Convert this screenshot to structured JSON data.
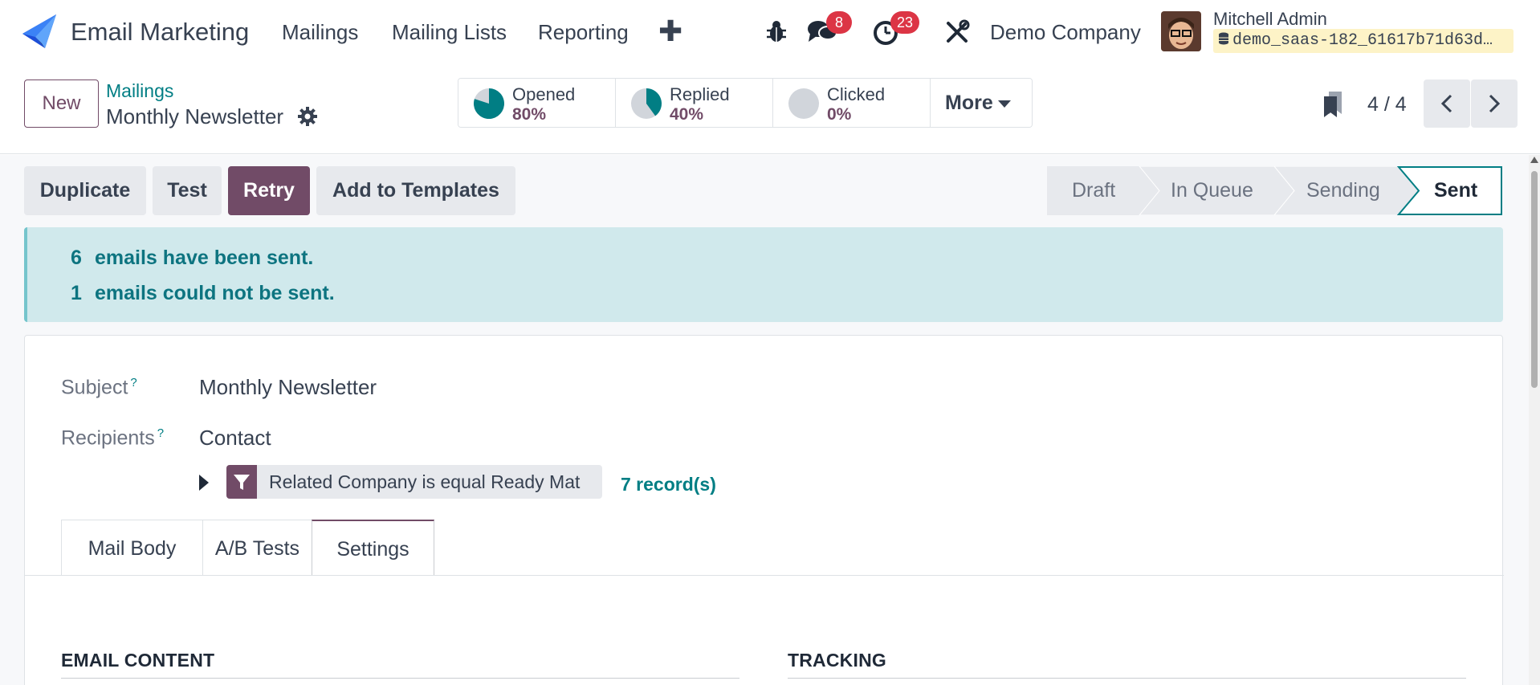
{
  "navbar": {
    "app_name": "Email Marketing",
    "menu": [
      {
        "label": "Mailings"
      },
      {
        "label": "Mailing Lists"
      },
      {
        "label": "Reporting"
      }
    ],
    "plus_glyph": "✚",
    "messages_count": "8",
    "activities_count": "23",
    "company": "Demo Company",
    "user_name": "Mitchell Admin",
    "database": "demo_saas-182_61617b71d63d…",
    "icons": [
      "app-logo-icon",
      "plus-icon",
      "bug-icon",
      "chat-icon",
      "clock-icon",
      "tools-icon",
      "database-icon",
      "avatar"
    ]
  },
  "control_panel": {
    "new_label": "New",
    "breadcrumb": "Mailings",
    "record_title": "Monthly Newsletter",
    "stats": [
      {
        "label": "Opened",
        "value": "80%",
        "fraction": 0.8
      },
      {
        "label": "Replied",
        "value": "40%",
        "fraction": 0.4
      },
      {
        "label": "Clicked",
        "value": "0%",
        "fraction": 0
      }
    ],
    "more_label": "More",
    "pager": "4 / 4"
  },
  "actions": {
    "duplicate": "Duplicate",
    "test": "Test",
    "retry": "Retry",
    "add_to_templates": "Add to Templates"
  },
  "statusbar": {
    "steps": [
      "Draft",
      "In Queue",
      "Sending",
      "Sent"
    ],
    "current": "Sent"
  },
  "alert": {
    "sent_count": "6",
    "sent_text": "emails have been sent.",
    "failed_count": "1",
    "failed_text": "emails could not be sent."
  },
  "form": {
    "subject_label": "Subject",
    "subject_value": "Monthly Newsletter",
    "recipients_label": "Recipients",
    "recipients_value": "Contact",
    "help_mark": "?",
    "domain_filter": "Related Company is equal Ready Mat",
    "records_link": "7 record(s)",
    "tabs": [
      {
        "label": "Mail Body"
      },
      {
        "label": "A/B Tests"
      },
      {
        "label": "Settings"
      }
    ],
    "active_tab": "Settings",
    "sections": {
      "email_content": "EMAIL CONTENT",
      "tracking": "TRACKING"
    }
  },
  "colors": {
    "brand": "#714b67",
    "link": "#017e84",
    "alert_bg": "#d0e9ec",
    "badge": "#dc3545"
  }
}
